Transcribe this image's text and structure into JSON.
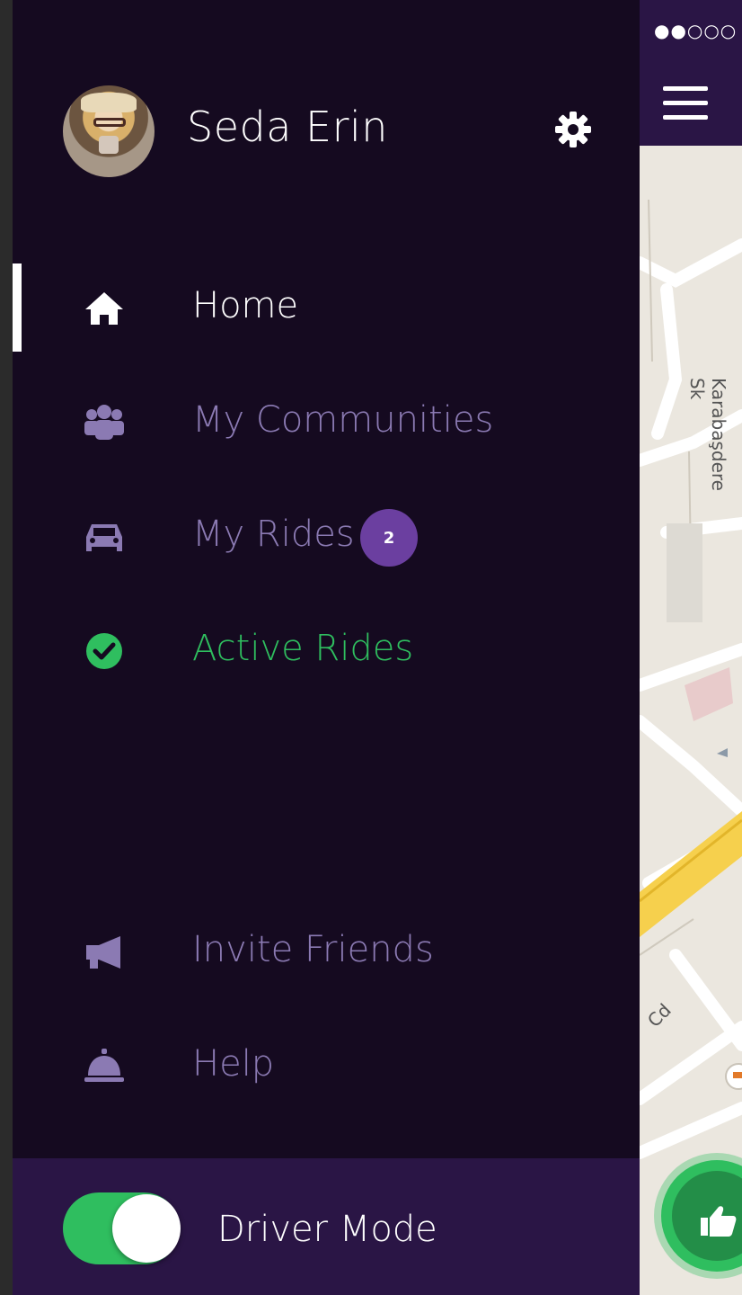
{
  "profile": {
    "name": "Seda Erin",
    "avatar_icon": "user-avatar",
    "settings_icon": "gear-icon"
  },
  "menu": {
    "items": [
      {
        "label": "Home",
        "icon": "home-icon",
        "state": "selected",
        "color": "#ffffff"
      },
      {
        "label": "My Communities",
        "icon": "community-icon",
        "color": "#8b7ab3"
      },
      {
        "label": "My Rides",
        "icon": "car-icon",
        "badge": "2",
        "color": "#8b7ab3"
      },
      {
        "label": "Active Rides",
        "icon": "check-circle-icon",
        "color": "#2fbe5f"
      },
      {
        "label": "Invite Friends",
        "icon": "megaphone-icon",
        "color": "#8b7ab3"
      },
      {
        "label": "Help",
        "icon": "service-bell-icon",
        "color": "#8b7ab3"
      }
    ]
  },
  "footer": {
    "toggle_label": "Driver Mode",
    "toggle_on": true
  },
  "status_bar": {
    "signal": "●●○○○"
  },
  "map": {
    "street_1": "Karabaşdere Sk",
    "street_2": "Cd"
  },
  "colors": {
    "drawer_bg": "#150a20",
    "header_bg": "#2a1545",
    "accent_green": "#2fbe5f",
    "accent_purple": "#6b3fa0",
    "muted_lavender": "#8b7ab3"
  }
}
